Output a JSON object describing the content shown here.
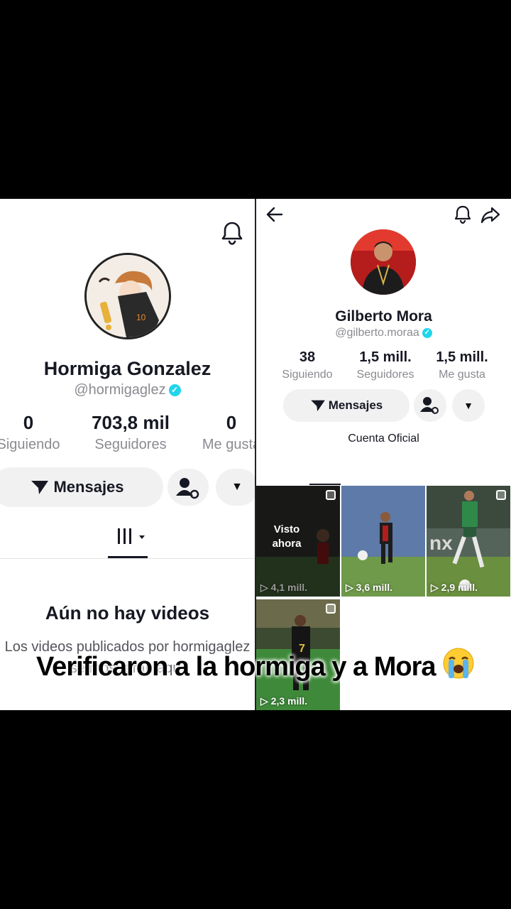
{
  "left_profile": {
    "name": "Hormiga Gonzalez",
    "handle": "@hormigaglez",
    "stats": [
      {
        "value": "0",
        "label": "Siguiendo"
      },
      {
        "value": "703,8 mil",
        "label": "Seguidores"
      },
      {
        "value": "0",
        "label": "Me gusta"
      }
    ],
    "message_button": "Mensajes",
    "empty_title": "Aún no hay videos",
    "empty_desc": "Los videos publicados por hormigaglez se mostrarán aquí"
  },
  "right_profile": {
    "name": "Gilberto Mora",
    "handle": "@gilberto.moraa",
    "stats": [
      {
        "value": "38",
        "label": "Siguiendo"
      },
      {
        "value": "1,5 mill.",
        "label": "Seguidores"
      },
      {
        "value": "1,5 mill.",
        "label": "Me gusta"
      }
    ],
    "message_button": "Mensajes",
    "official_label": "Cuenta Oficial",
    "videos": [
      {
        "views": "4,1 mill.",
        "overlay": "Visto ahora"
      },
      {
        "views": "3,6 mill."
      },
      {
        "views": "2,9 mill."
      },
      {
        "views": "2,3 mill."
      }
    ]
  },
  "caption": {
    "text": "Verificaron a la hormiga y a Mora",
    "emoji": "loudly-crying-face"
  },
  "colors": {
    "verified": "#20d5ec",
    "text_primary": "#161823",
    "text_secondary": "#8a8b91",
    "button_bg": "#f1f1f2"
  }
}
